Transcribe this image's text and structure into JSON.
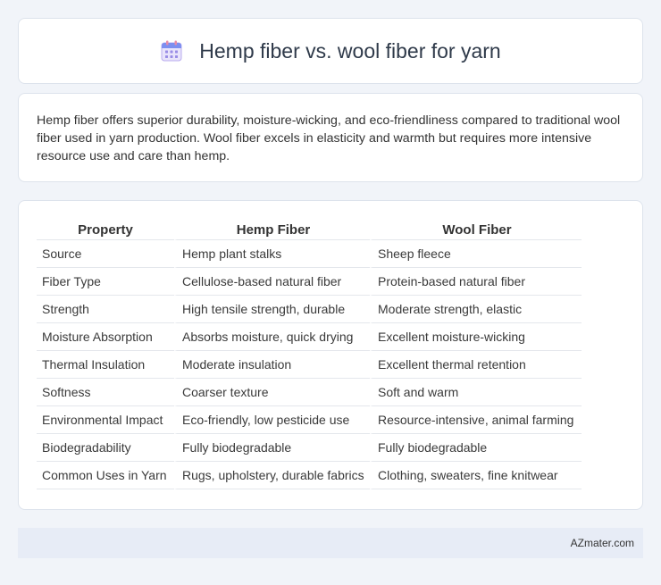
{
  "header": {
    "title": "Hemp fiber vs. wool fiber for yarn",
    "icon": "calendar-icon"
  },
  "summary": "Hemp fiber offers superior durability, moisture-wicking, and eco-friendliness compared to traditional wool fiber used in yarn production. Wool fiber excels in elasticity and warmth but requires more intensive resource use and care than hemp.",
  "table": {
    "headers": [
      "Property",
      "Hemp Fiber",
      "Wool Fiber"
    ],
    "rows": [
      [
        "Source",
        "Hemp plant stalks",
        "Sheep fleece"
      ],
      [
        "Fiber Type",
        "Cellulose-based natural fiber",
        "Protein-based natural fiber"
      ],
      [
        "Strength",
        "High tensile strength, durable",
        "Moderate strength, elastic"
      ],
      [
        "Moisture Absorption",
        "Absorbs moisture, quick drying",
        "Excellent moisture-wicking"
      ],
      [
        "Thermal Insulation",
        "Moderate insulation",
        "Excellent thermal retention"
      ],
      [
        "Softness",
        "Coarser texture",
        "Soft and warm"
      ],
      [
        "Environmental Impact",
        "Eco-friendly, low pesticide use",
        "Resource-intensive, animal farming"
      ],
      [
        "Biodegradability",
        "Fully biodegradable",
        "Fully biodegradable"
      ],
      [
        "Common Uses in Yarn",
        "Rugs, upholstery, durable fabrics",
        "Clothing, sweaters, fine knitwear"
      ]
    ]
  },
  "footer": {
    "brand": "AZmater.com"
  }
}
